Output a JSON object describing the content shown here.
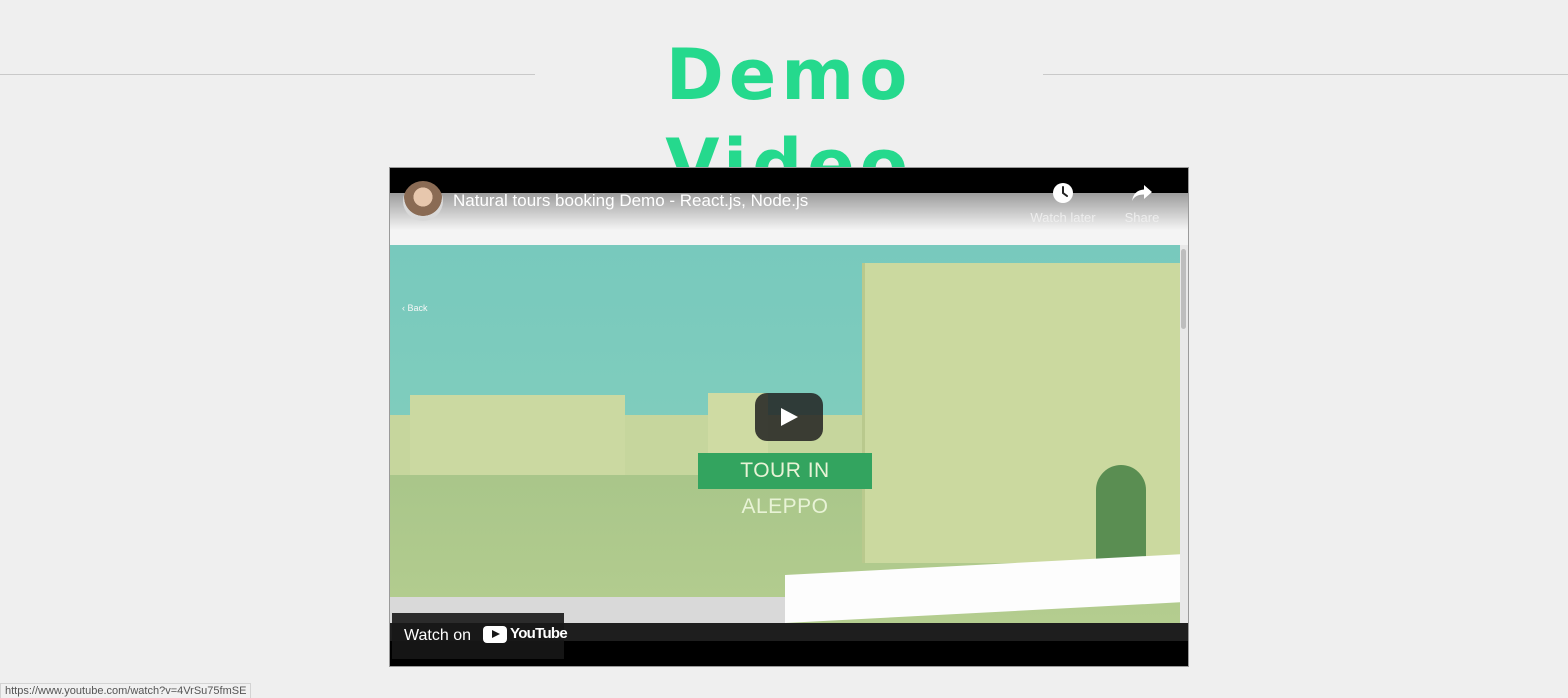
{
  "page": {
    "title": "Demo Video",
    "accent_color": "#25d98d"
  },
  "video": {
    "title": "Natural tours booking Demo - React.js, Node.js",
    "channel_avatar_icon": "avatar",
    "watch_later_label": "Watch later",
    "share_label": "Share",
    "watch_on_label": "Watch on",
    "youtube_logo_text": "YouTube",
    "scene": {
      "badge_text": "TOUR IN ALEPPO",
      "back_label": "Back"
    }
  },
  "status_bar": {
    "url": "https://www.youtube.com/watch?v=4VrSu75fmSE"
  }
}
